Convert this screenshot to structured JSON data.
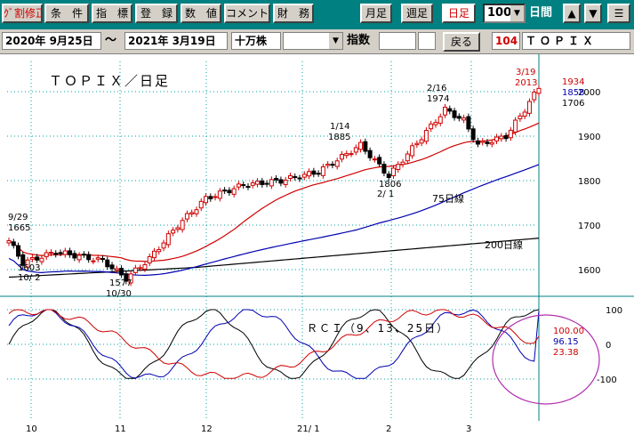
{
  "toolbar": {
    "buttons": [
      {
        "label": "ｸﾞ割修正",
        "color": "#d00000"
      },
      {
        "label": "条　件"
      },
      {
        "label": "指　標"
      },
      {
        "label": "登　録"
      },
      {
        "label": "数　値"
      },
      {
        "label": "コメント"
      },
      {
        "label": "財　務"
      }
    ],
    "period_buttons": [
      "月足",
      "週足",
      "日足"
    ],
    "period_count": "100",
    "period_unit": "日間",
    "nav_up": "▲",
    "nav_down": "▼",
    "menu_icon": "☰"
  },
  "infobar": {
    "start_date": "2020年  9月25日",
    "range_sep": "〜",
    "end_date": "2021年  3月19日",
    "unit": "十万株",
    "index_label": "指数",
    "back_label": "戻る",
    "code": "104",
    "name": "ＴＯＰＩＸ"
  },
  "chart_data": [
    {
      "type": "candlestick",
      "title": "ＴＯＰＩＸ／日足",
      "ylim": [
        1550,
        2050
      ],
      "yticks": [
        1600,
        1700,
        1800,
        1900,
        2000
      ],
      "xtick_labels": [
        "10",
        "11",
        "12",
        "21/ 1",
        "2",
        "3"
      ],
      "grid": true,
      "last_bar": {
        "date": "3/19",
        "open": 2013,
        "high": 2013,
        "low": 1858,
        "close": 1934
      },
      "legend_values": [
        {
          "value": "1934",
          "color": "#d00000"
        },
        {
          "value": "1858",
          "color": "#0000b0"
        },
        {
          "value": "1706",
          "color": "#000000"
        }
      ],
      "ma_labels": [
        {
          "text": "75日線"
        },
        {
          "text": "200日線"
        }
      ],
      "annotations": [
        {
          "date": "9/29",
          "value": "1665"
        },
        {
          "date": "10/ 2",
          "value": "1603"
        },
        {
          "date": "10/30",
          "value": "1577"
        },
        {
          "date": "1/14",
          "value": "1885"
        },
        {
          "date": "2/ 1",
          "value": "1806"
        },
        {
          "date": "2/16",
          "value": "1974"
        },
        {
          "date": "3/19",
          "value": "2013"
        }
      ],
      "series_colors": {
        "up": "#d00000",
        "down": "#000000",
        "ma25": "#d00000",
        "ma75": "#0000b0",
        "ma200": "#000000"
      }
    },
    {
      "type": "line",
      "title": "ＲＣＩ（9、13、25日）",
      "ylim": [
        -100,
        100
      ],
      "yticks": [
        100,
        0,
        -100
      ],
      "legend_values": [
        {
          "value": "100.00",
          "color": "#d00000"
        },
        {
          "value": "96.15",
          "color": "#0000b0"
        },
        {
          "value": "23.38",
          "color": "#d00000"
        }
      ]
    }
  ]
}
